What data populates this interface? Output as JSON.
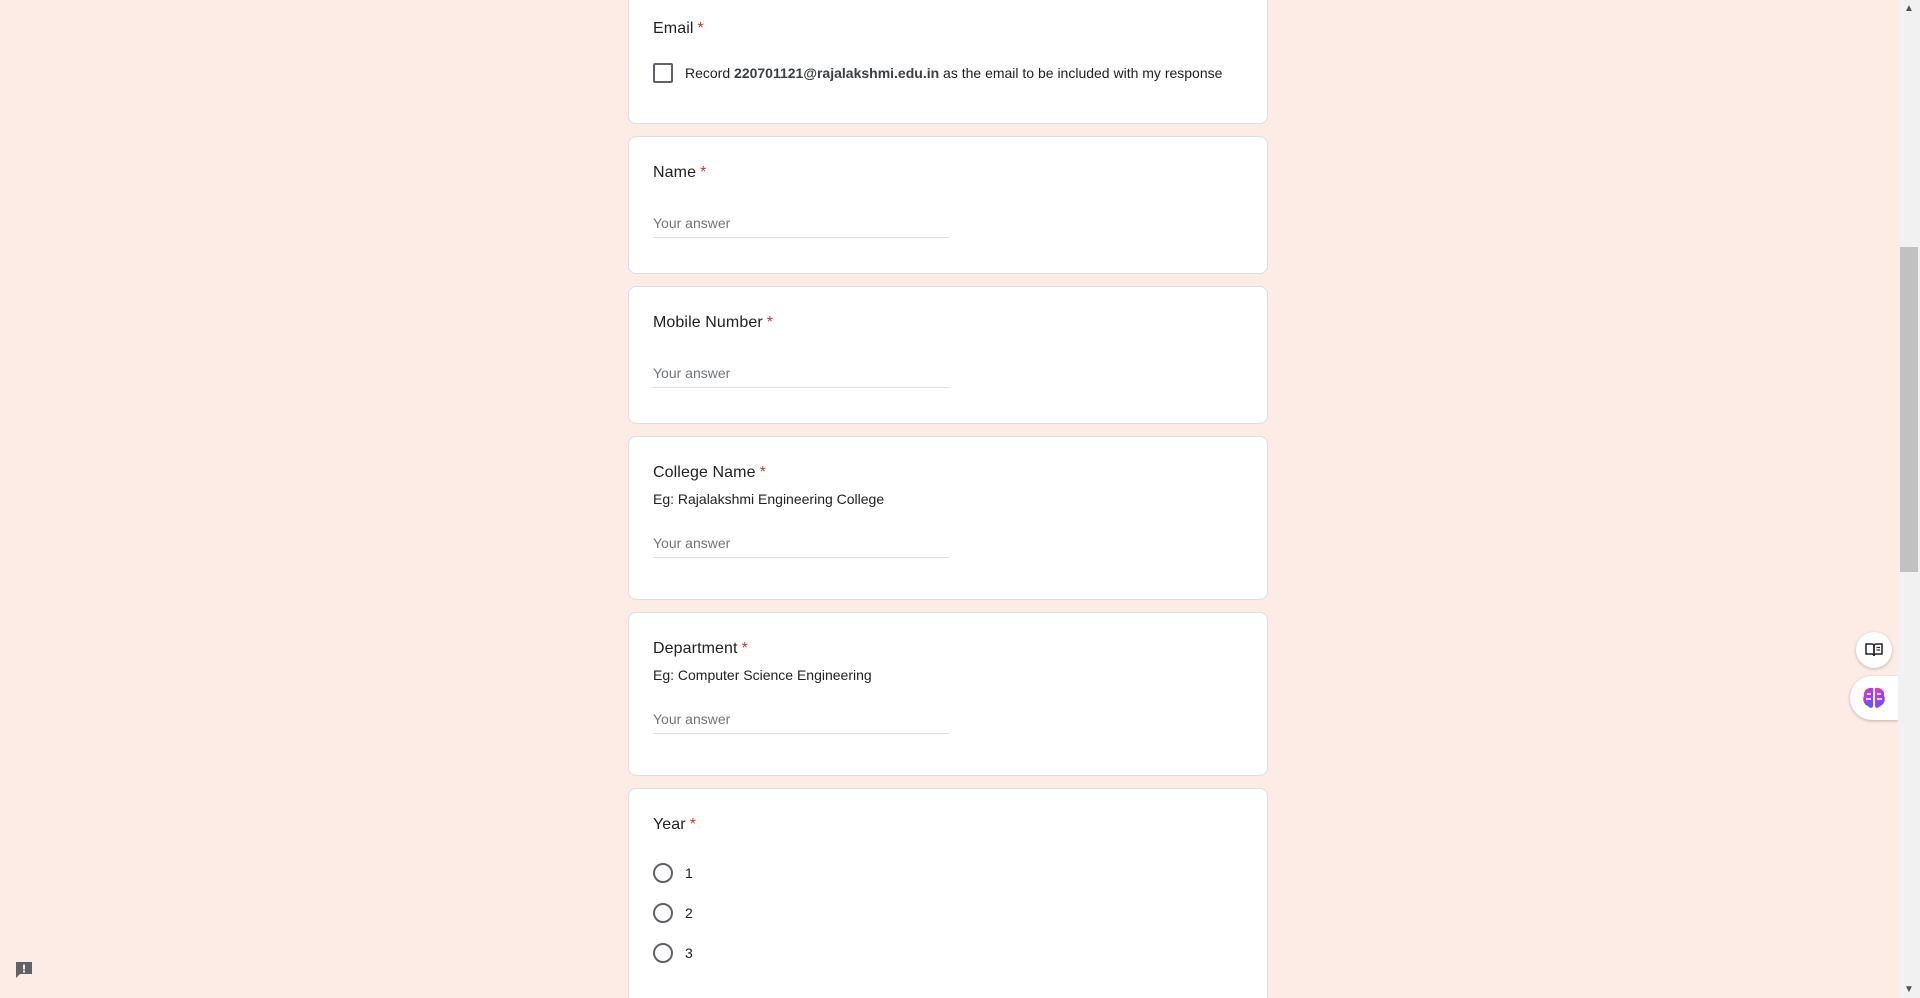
{
  "email_card": {
    "title": "Email",
    "required_mark": "*",
    "record_prefix": "Record",
    "record_email": "220701121@rajalakshmi.edu.in",
    "record_suffix": "as the email to be included with my response"
  },
  "questions": {
    "name": {
      "title": "Name",
      "required_mark": "*",
      "placeholder": "Your answer"
    },
    "mobile": {
      "title": "Mobile Number",
      "required_mark": "*",
      "placeholder": "Your answer"
    },
    "college": {
      "title": "College Name",
      "required_mark": "*",
      "description": "Eg: Rajalakshmi Engineering College",
      "placeholder": "Your answer"
    },
    "department": {
      "title": "Department",
      "required_mark": "*",
      "description": "Eg: Computer Science Engineering",
      "placeholder": "Your answer"
    },
    "year": {
      "title": "Year",
      "required_mark": "*",
      "options": [
        "1",
        "2",
        "3"
      ]
    }
  },
  "scrollbar": {
    "up_glyph": "▲",
    "down_glyph": "▼"
  },
  "colors": {
    "background": "#fdece6",
    "required": "#d93025",
    "card": "#ffffff"
  },
  "icons": {
    "reader": "reader-mode-icon",
    "brain": "brain-extension-icon",
    "report": "report-problem-icon"
  }
}
